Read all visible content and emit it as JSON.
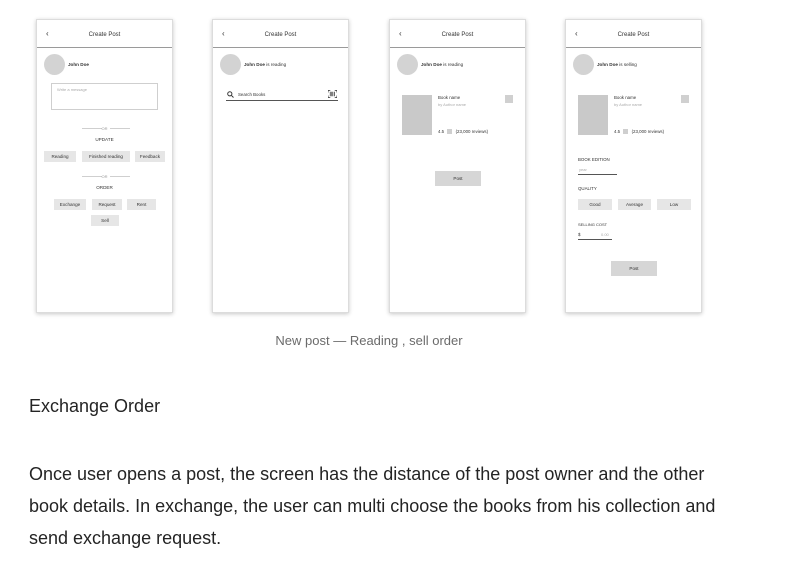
{
  "screens": [
    {
      "title": "Create Post",
      "user": "John Doe",
      "message_placeholder": "Write a message",
      "or_label": "OR",
      "update_label": "UPDATE",
      "update_buttons": [
        "Reading",
        "Finished reading",
        "Feedback"
      ],
      "or_label_2": "OR",
      "order_label": "ORDER",
      "order_buttons": [
        "Exchange",
        "Request",
        "Rent",
        "Sell"
      ]
    },
    {
      "title": "Create Post",
      "user": "John Doe",
      "status": "is reading",
      "search_placeholder": "Search Books"
    },
    {
      "title": "Create Post",
      "user": "John Doe",
      "status": "is reading",
      "book_name": "Book name",
      "author": "by Author name",
      "rating": "4.5",
      "reviews": "(23,000 reviews)",
      "post_button": "Post"
    },
    {
      "title": "Create Post",
      "user": "John Doe",
      "status": "is selling",
      "book_name": "Book name",
      "author": "by Author name",
      "rating": "4.5",
      "reviews": "(23,000 reviews)",
      "edition_label": "BOOK EDITION",
      "edition_placeholder": "year",
      "quality_label": "QUALITY",
      "quality_options": [
        "Good",
        "Average",
        "Low"
      ],
      "cost_label": "SELLING COST",
      "currency": "$",
      "cost_placeholder": "0.00",
      "post_button": "Post"
    }
  ],
  "caption": "New post — Reading , sell order",
  "section_heading": "Exchange Order",
  "paragraph": "Once user opens a post, the screen has the distance of the post owner and the other book details. In exchange, the user can multi choose the books from his collection and send exchange request."
}
